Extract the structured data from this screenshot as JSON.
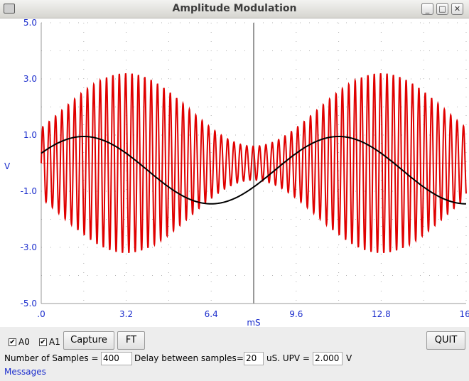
{
  "window": {
    "title": "Amplitude Modulation"
  },
  "titlebar_buttons": {
    "minimize": "_",
    "maximize": "□",
    "close": "✕"
  },
  "chart_data": {
    "type": "line",
    "xlabel": "mS",
    "ylabel": "V",
    "xlim": [
      0,
      16
    ],
    "ylim": [
      -5,
      5
    ],
    "x_ticks": [
      ".0",
      "3.2",
      "6.4",
      "9.6",
      "12.8",
      "16."
    ],
    "y_ticks": [
      "5.0",
      "3.0",
      "1.0",
      "-1.0",
      "-3.0",
      "-5.0"
    ],
    "grid": true,
    "series": [
      {
        "color": "#e00000",
        "carrier_period_ms": 0.24,
        "envelope_period_ms": 9.6,
        "peak_max": 3.2,
        "peak_min": 0.6
      },
      {
        "color": "#000000",
        "period_ms": 9.6,
        "amplitude": 1.2,
        "phase_deg": 30
      }
    ]
  },
  "controls": {
    "a0_label": "A0",
    "a1_label": "A1",
    "a0_checked": true,
    "a1_checked": true,
    "capture_label": "Capture",
    "ft_label": "FT",
    "quit_label": "QUIT",
    "samples_label": "Number of Samples =",
    "samples_value": "400",
    "delay_label": "Delay between samples=",
    "delay_value": "20",
    "upv_label": "uS. UPV =",
    "upv_value": "2.000",
    "upv_unit": "V",
    "messages_label": "Messages"
  }
}
